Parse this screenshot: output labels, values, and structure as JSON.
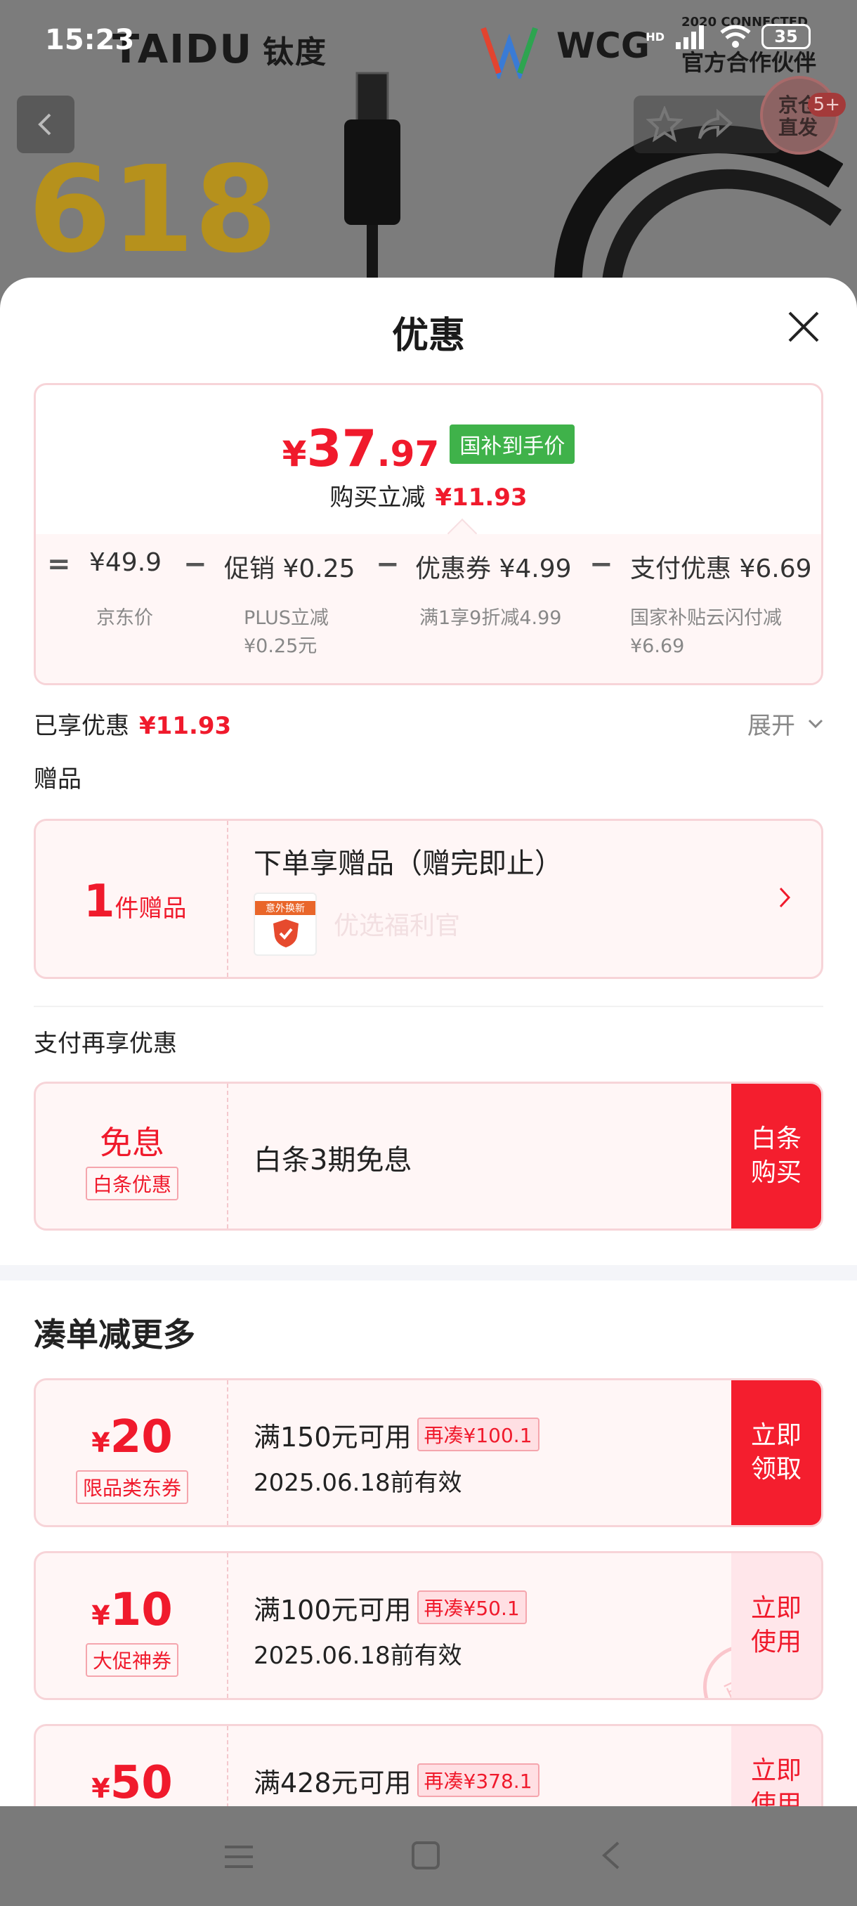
{
  "status_bar": {
    "time": "15:23",
    "network": "HD",
    "battery": "35"
  },
  "banner": {
    "brand_left": "TAIDU",
    "brand_left_cn": "钛度",
    "wcg": "WCG",
    "wcg_small": "2020 CONNECTED",
    "wcg_cn": "官方合作伙伴",
    "promo": "618",
    "jd_badge": "京仓\n直发",
    "jd_count": "5+"
  },
  "sheet": {
    "title": "优惠"
  },
  "price_card": {
    "currency": "¥",
    "price_int": "37",
    "price_dec": ".97",
    "tag": "国补到手价",
    "sub_label": "购买立减",
    "sub_value": "¥11.93",
    "breakdown": [
      {
        "op": "=",
        "label": "",
        "value": "¥49.9",
        "desc": "京东价"
      },
      {
        "op": "−",
        "label": "促销",
        "value": "¥0.25",
        "desc": "PLUS立减\n¥0.25元"
      },
      {
        "op": "−",
        "label": "优惠券",
        "value": "¥4.99",
        "desc": "满1享9折减4.99"
      },
      {
        "op": "−",
        "label": "支付优惠",
        "value": "¥6.69",
        "desc": "国家补贴云闪付减\n¥6.69"
      }
    ]
  },
  "enjoyed": {
    "label": "已享优惠",
    "value": "¥11.93",
    "expand": "展开"
  },
  "gift": {
    "section": "赠品",
    "count": "1",
    "count_unit": "件赠品",
    "title": "下单享赠品（赠完即止）",
    "item_name": "优选福利官",
    "thumb_text": "意外换新"
  },
  "payment": {
    "section": "支付再享优惠",
    "left_title": "免息",
    "left_tag": "白条优惠",
    "title": "白条3期免息",
    "action": "白条\n购买"
  },
  "more": {
    "section": "凑单减更多",
    "coupons": [
      {
        "amount": "20",
        "tag": "限品类东券",
        "condition": "满150元可用",
        "extra": "再凑¥100.1",
        "date": "2025.06.18前有效",
        "action": "立即\n领取",
        "style": "solid"
      },
      {
        "amount": "10",
        "tag": "大促神券",
        "condition": "满100元可用",
        "extra": "再凑¥50.1",
        "date": "2025.06.18前有效",
        "action": "立即\n使用",
        "style": "soft",
        "stamp": "已领"
      },
      {
        "amount": "50",
        "tag": "",
        "condition": "满428元可用",
        "extra": "再凑¥378.1",
        "date": "",
        "action": "立即\n使用",
        "style": "soft"
      }
    ]
  },
  "colors": {
    "accent_red": "#f01a2c",
    "green_tag": "#3fb24a",
    "card_bg": "#fff6f6",
    "card_border": "#f7d4d8"
  }
}
